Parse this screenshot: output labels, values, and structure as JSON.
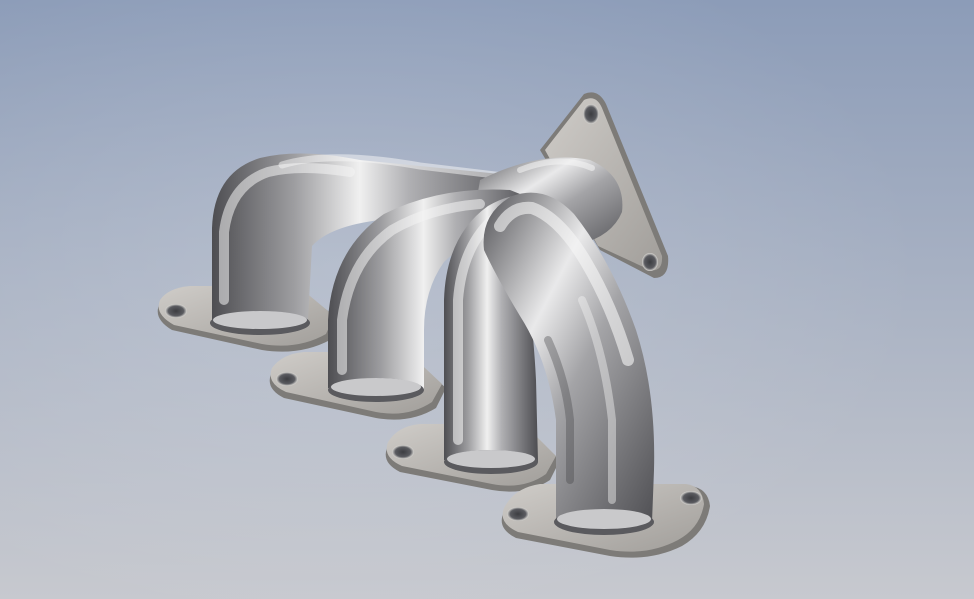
{
  "viewport": {
    "background_top": "#8c9cb8",
    "background_bottom": "#c7c9cf"
  },
  "model": {
    "part": "exhaust-manifest",
    "runner_count": 4,
    "metal_light": "#f2f2f2",
    "metal_mid": "#b8b8ba",
    "metal_dark": "#5f5f62",
    "metal_shadow": "#3f3f42",
    "flange_face": "#b9b6b2",
    "flange_edge": "#7d7b78",
    "bolt_hole": "#55565a"
  }
}
